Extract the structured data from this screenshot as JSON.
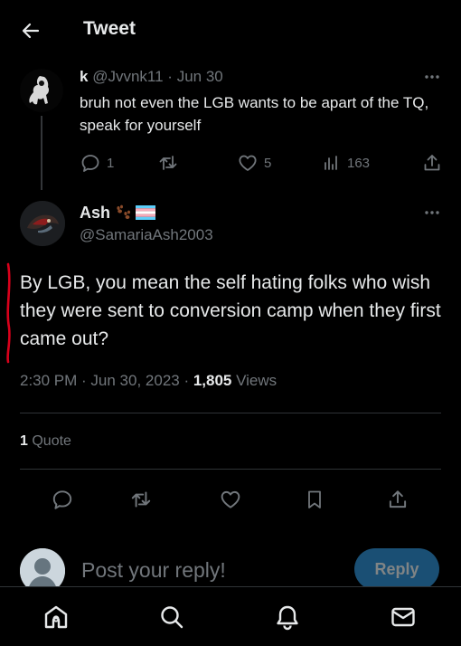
{
  "header": {
    "title": "Tweet"
  },
  "parent_tweet": {
    "name": "k",
    "handle": "@Jvvnk11",
    "separator": "·",
    "date": "Jun 30",
    "text": "bruh not even the LGB wants to be apart of the TQ, speak for yourself",
    "replies": "1",
    "likes": "5",
    "views": "163"
  },
  "main_tweet": {
    "name": "Ash",
    "name_emojis": "paw-prints-emoji, transgender-flag-emoji",
    "handle": "@SamariaAsh2003",
    "text": "By LGB, you mean the self hating folks who wish they were sent to conversion camp when they first came out?",
    "time": "2:30 PM · Jun 30, 2023 · ",
    "views_count": "1,805",
    "views_label": " Views",
    "quotes_count": "1",
    "quotes_label": " Quote"
  },
  "composer": {
    "placeholder": "Post your reply!",
    "reply_label": "Reply"
  },
  "colors": {
    "background": "#000000",
    "text": "#e7e9ea",
    "muted": "#71767b",
    "divider": "#2f3336",
    "reply_button": "#1a4f74",
    "annotation_red": "#d9001b"
  },
  "icons": [
    "back-arrow-icon",
    "more-icon",
    "reply-icon",
    "retweet-icon",
    "like-icon",
    "views-icon",
    "share-icon",
    "bookmark-icon",
    "home-icon",
    "search-icon",
    "notifications-icon",
    "messages-icon"
  ]
}
